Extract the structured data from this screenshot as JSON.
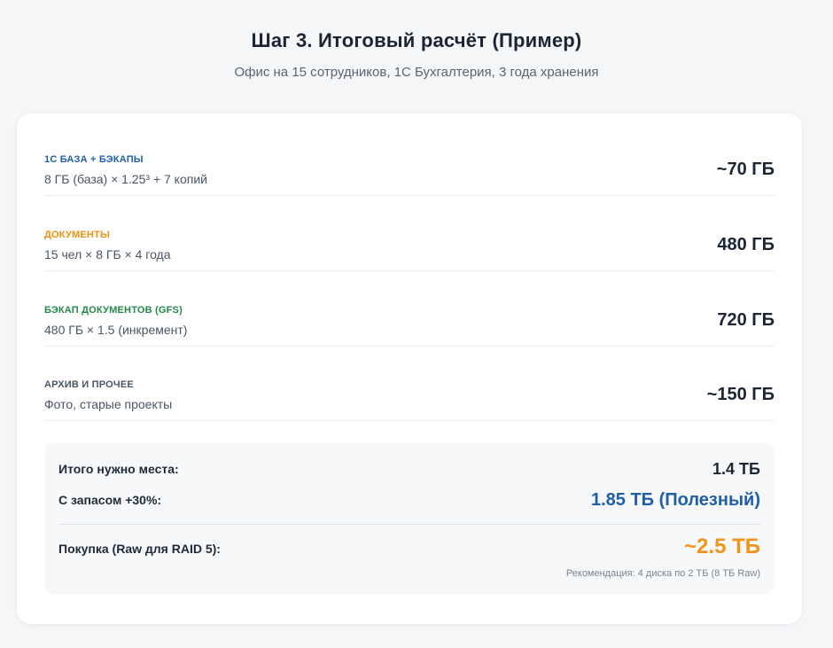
{
  "header": {
    "title": "Шаг 3. Итоговый расчёт (Пример)",
    "subtitle": "Офис на 15 сотрудников, 1С Бухгалтерия, 3 года хранения"
  },
  "rows": [
    {
      "label": "1С БАЗА + БЭКАПЫ",
      "formula": "8 ГБ (база) × 1.25³ + 7 копий",
      "value": "~70 ГБ",
      "color": "#1f5fa8"
    },
    {
      "label": "ДОКУМЕНТЫ",
      "formula": "15 чел × 8 ГБ × 4 года",
      "value": "480 ГБ",
      "color": "#e8920e"
    },
    {
      "label": "БЭКАП ДОКУМЕНТОВ (GFS)",
      "formula": "480 ГБ × 1.5 (инкремент)",
      "value": "720 ГБ",
      "color": "#24874a"
    },
    {
      "label": "АРХИВ И ПРОЧЕЕ",
      "formula": "Фото, старые проекты",
      "value": "~150 ГБ",
      "color": "#4a5563"
    }
  ],
  "summary": {
    "total_label": "Итого нужно места:",
    "total_value": "1.4 ТБ",
    "reserve_label": "С запасом +30%:",
    "reserve_value": "1.85 ТБ (Полезный)",
    "reserve_color": "#1f5fa8",
    "purchase_label": "Покупка (Raw для RAID 5):",
    "purchase_value": "~2.5 ТБ",
    "purchase_color": "#f0941a",
    "recommendation": "Рекомендация: 4 диска по 2 ТБ (8 ТБ Raw)"
  }
}
